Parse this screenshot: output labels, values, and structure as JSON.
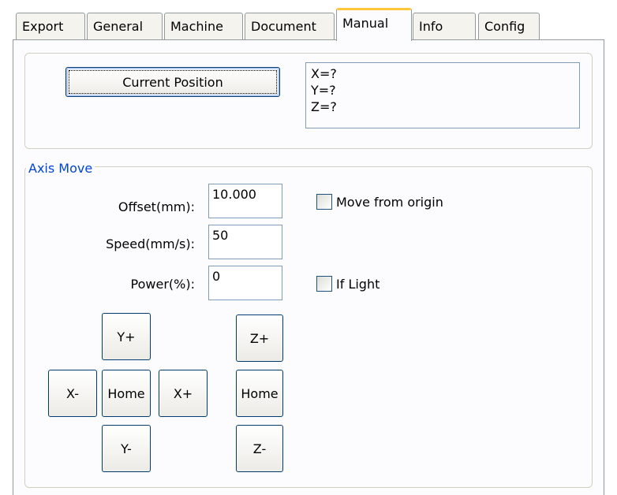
{
  "tabs": [
    "Export",
    "General",
    "Machine",
    "Document",
    "Manual",
    "Info",
    "Config"
  ],
  "active_tab": "Manual",
  "position": {
    "button_label": "Current Position",
    "readout": [
      "X=?",
      "Y=?",
      "Z=?"
    ]
  },
  "axis_move": {
    "title": "Axis Move",
    "offset_label": "Offset(mm):",
    "offset_value": "10.000",
    "speed_label": "Speed(mm/s):",
    "speed_value": "50",
    "power_label": "Power(%):",
    "power_value": "0",
    "move_from_origin_label": "Move from origin",
    "if_light_label": "If Light"
  },
  "jog": {
    "y_plus": "Y+",
    "y_minus": "Y-",
    "x_minus": "X-",
    "x_plus": "X+",
    "xy_home": "Home",
    "z_plus": "Z+",
    "z_home": "Home",
    "z_minus": "Z-"
  },
  "colors": {
    "accent_tab": "#ffc83c",
    "group_title": "#0046d5",
    "button_border": "#003c74"
  }
}
